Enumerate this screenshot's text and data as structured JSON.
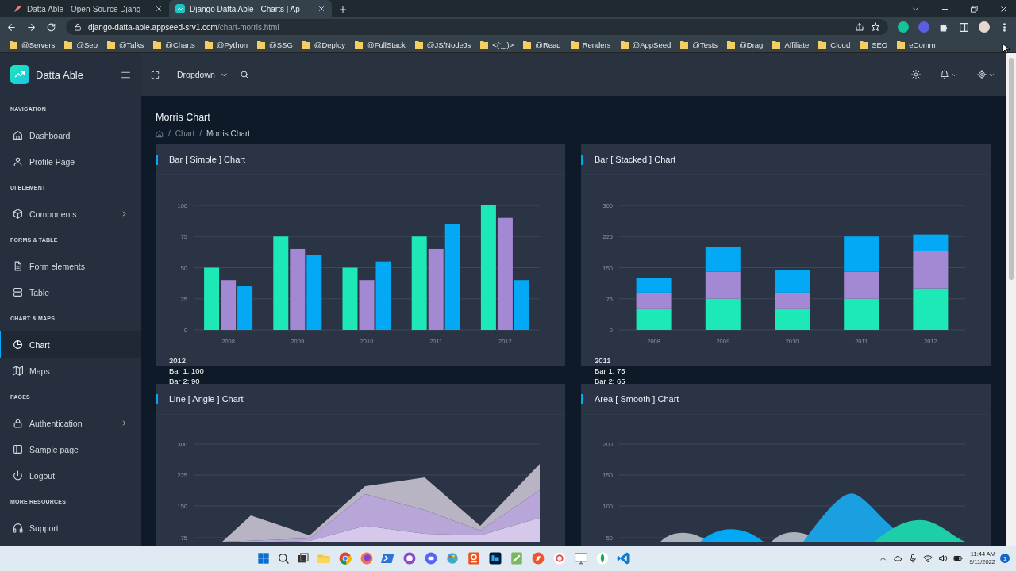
{
  "browser": {
    "tabs": [
      {
        "title": "Datta Able - Open-Source Djang",
        "selected": false
      },
      {
        "title": "Django Datta Able - Charts | Ap",
        "selected": true
      }
    ],
    "address": {
      "host": "django-datta-able.appseed-srv1.com",
      "path": "/chart-morris.html"
    },
    "bookmarks": [
      "@Servers",
      "@Seo",
      "@Talks",
      "@Charts",
      "@Python",
      "@SSG",
      "@Deploy",
      "@FullStack",
      "@JS/NodeJs",
      "<(‘_’)>",
      "@Read",
      "Renders",
      "@AppSeed",
      "@Tests",
      "@Drag",
      "Affiliate",
      "Cloud",
      "SEO",
      "eComm"
    ]
  },
  "sidebar": {
    "brand": "Datta Able",
    "sections": [
      {
        "title": "NAVIGATION",
        "items": [
          {
            "label": "Dashboard",
            "selected": false,
            "submenu": false
          },
          {
            "label": "Profile Page",
            "selected": false,
            "submenu": false
          }
        ]
      },
      {
        "title": "UI ELEMENT",
        "items": [
          {
            "label": "Components",
            "selected": false,
            "submenu": true
          }
        ]
      },
      {
        "title": "FORMS & TABLE",
        "items": [
          {
            "label": "Form elements",
            "selected": false,
            "submenu": false
          },
          {
            "label": "Table",
            "selected": false,
            "submenu": false
          }
        ]
      },
      {
        "title": "CHART & MAPS",
        "items": [
          {
            "label": "Chart",
            "selected": true,
            "submenu": false
          },
          {
            "label": "Maps",
            "selected": false,
            "submenu": false
          }
        ]
      },
      {
        "title": "PAGES",
        "items": [
          {
            "label": "Authentication",
            "selected": false,
            "submenu": true
          },
          {
            "label": "Sample page",
            "selected": false,
            "submenu": false
          },
          {
            "label": "Logout",
            "selected": false,
            "submenu": false
          }
        ]
      },
      {
        "title": "MORE RESOURCES",
        "items": [
          {
            "label": "Support",
            "selected": false,
            "submenu": false
          }
        ]
      }
    ]
  },
  "header": {
    "dropdown": "Dropdown"
  },
  "page": {
    "title": "Morris Chart",
    "breadcrumb": [
      {
        "separator": "/",
        "label": "Chart"
      },
      {
        "separator": "/",
        "label": "Morris Chart"
      }
    ]
  },
  "cards": [
    {
      "title": "Bar [ Simple ] Chart",
      "kind": "bar_chart",
      "chart_data": {
        "type": "bar",
        "categories": [
          "2008",
          "2009",
          "2010",
          "2011",
          "2012"
        ],
        "series": [
          {
            "color": "#1de9b6",
            "values": [
              50,
              75,
              50,
              75,
              100
            ]
          },
          {
            "color": "#a389d4",
            "values": [
              40,
              65,
              40,
              65,
              90
            ]
          },
          {
            "color": "#04a9f5",
            "values": [
              35,
              60,
              55,
              85,
              40
            ]
          }
        ],
        "ylim": [
          0,
          100
        ],
        "yticks": [
          {
            "value": 0,
            "label": "0"
          },
          {
            "value": 25,
            "label": "25"
          },
          {
            "value": 50,
            "label": "50"
          },
          {
            "value": 75,
            "label": "75"
          },
          {
            "value": 100,
            "label": "100"
          }
        ],
        "stacked": false,
        "grid": true
      },
      "tooltip": [
        "2012",
        "Bar 1: 100",
        "Bar 2: 90"
      ]
    },
    {
      "title": "Bar [ Stacked ] Chart",
      "kind": "bar_chart",
      "chart_data": {
        "type": "bar",
        "categories": [
          "2008",
          "2009",
          "2010",
          "2011",
          "2012"
        ],
        "series": [
          {
            "color": "#1de9b6",
            "values": [
              50,
              75,
              50,
              75,
              100
            ]
          },
          {
            "color": "#a389d4",
            "values": [
              40,
              65,
              40,
              65,
              90
            ]
          },
          {
            "color": "#04a9f5",
            "values": [
              35,
              60,
              55,
              85,
              40
            ]
          }
        ],
        "ylim": [
          0,
          300
        ],
        "yticks": [
          {
            "value": 0,
            "label": "0"
          },
          {
            "value": 75,
            "label": "75"
          },
          {
            "value": 150,
            "label": "150"
          },
          {
            "value": 225,
            "label": "225"
          },
          {
            "value": 300,
            "label": "300"
          }
        ],
        "stacked": true,
        "grid": true
      },
      "tooltip": [
        "2011",
        "Bar 1: 75",
        "Bar 2: 65"
      ]
    },
    {
      "title": "Line [ Angle ] Chart",
      "kind": "line_chart",
      "tick_labels": [
        "300",
        "225",
        "150",
        "75"
      ]
    },
    {
      "title": "Area [ Smooth ] Chart",
      "kind": "area_chart",
      "tick_labels": [
        "200",
        "150",
        "100",
        "50"
      ]
    }
  ],
  "taskbar": {
    "time": "11:44 AM",
    "date": "9/11/2022",
    "notifications": "1"
  }
}
